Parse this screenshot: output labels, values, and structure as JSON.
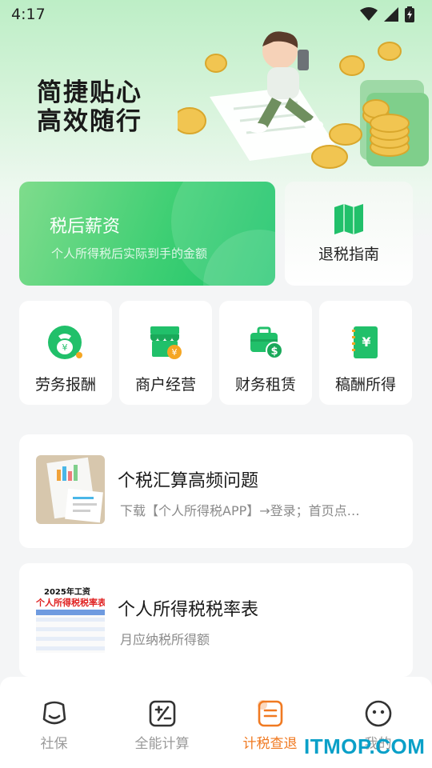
{
  "status_bar": {
    "time": "4:17"
  },
  "hero": {
    "slogan_line1": "简捷贴心",
    "slogan_line2": "高效随行"
  },
  "feature_cards": {
    "salary": {
      "title": "税后薪资",
      "subtitle": "个人所得税后实际到手的金额"
    },
    "refund_guide": {
      "label": "退税指南",
      "icon": "map-book-icon"
    }
  },
  "tools": [
    {
      "label": "劳务报酬",
      "icon": "money-bag-icon"
    },
    {
      "label": "商户经营",
      "icon": "shop-icon"
    },
    {
      "label": "财务租赁",
      "icon": "briefcase-dollar-icon"
    },
    {
      "label": "稿酬所得",
      "icon": "notebook-yen-icon"
    }
  ],
  "articles": [
    {
      "title": "个税汇算高频问题",
      "desc": "下载【个人所得税APP】→登录；首页点…"
    },
    {
      "title": "个人所得税税率表",
      "desc": "月应纳税所得额",
      "thumb_heading": "2025年工资",
      "thumb_subheading": "个人所得税税率表"
    }
  ],
  "tabbar": [
    {
      "label": "社保",
      "icon": "shield-face-icon",
      "active": false
    },
    {
      "label": "全能计算",
      "icon": "calculator-icon",
      "active": false
    },
    {
      "label": "计税查退",
      "icon": "document-list-icon",
      "active": true
    },
    {
      "label": "我的",
      "icon": "smiley-icon",
      "active": false
    }
  ],
  "watermark": "ITMOP.COM",
  "colors": {
    "accent_green": "#2ecb6f",
    "active_tab": "#f07a22",
    "inactive_tab": "#9a9a9a"
  }
}
